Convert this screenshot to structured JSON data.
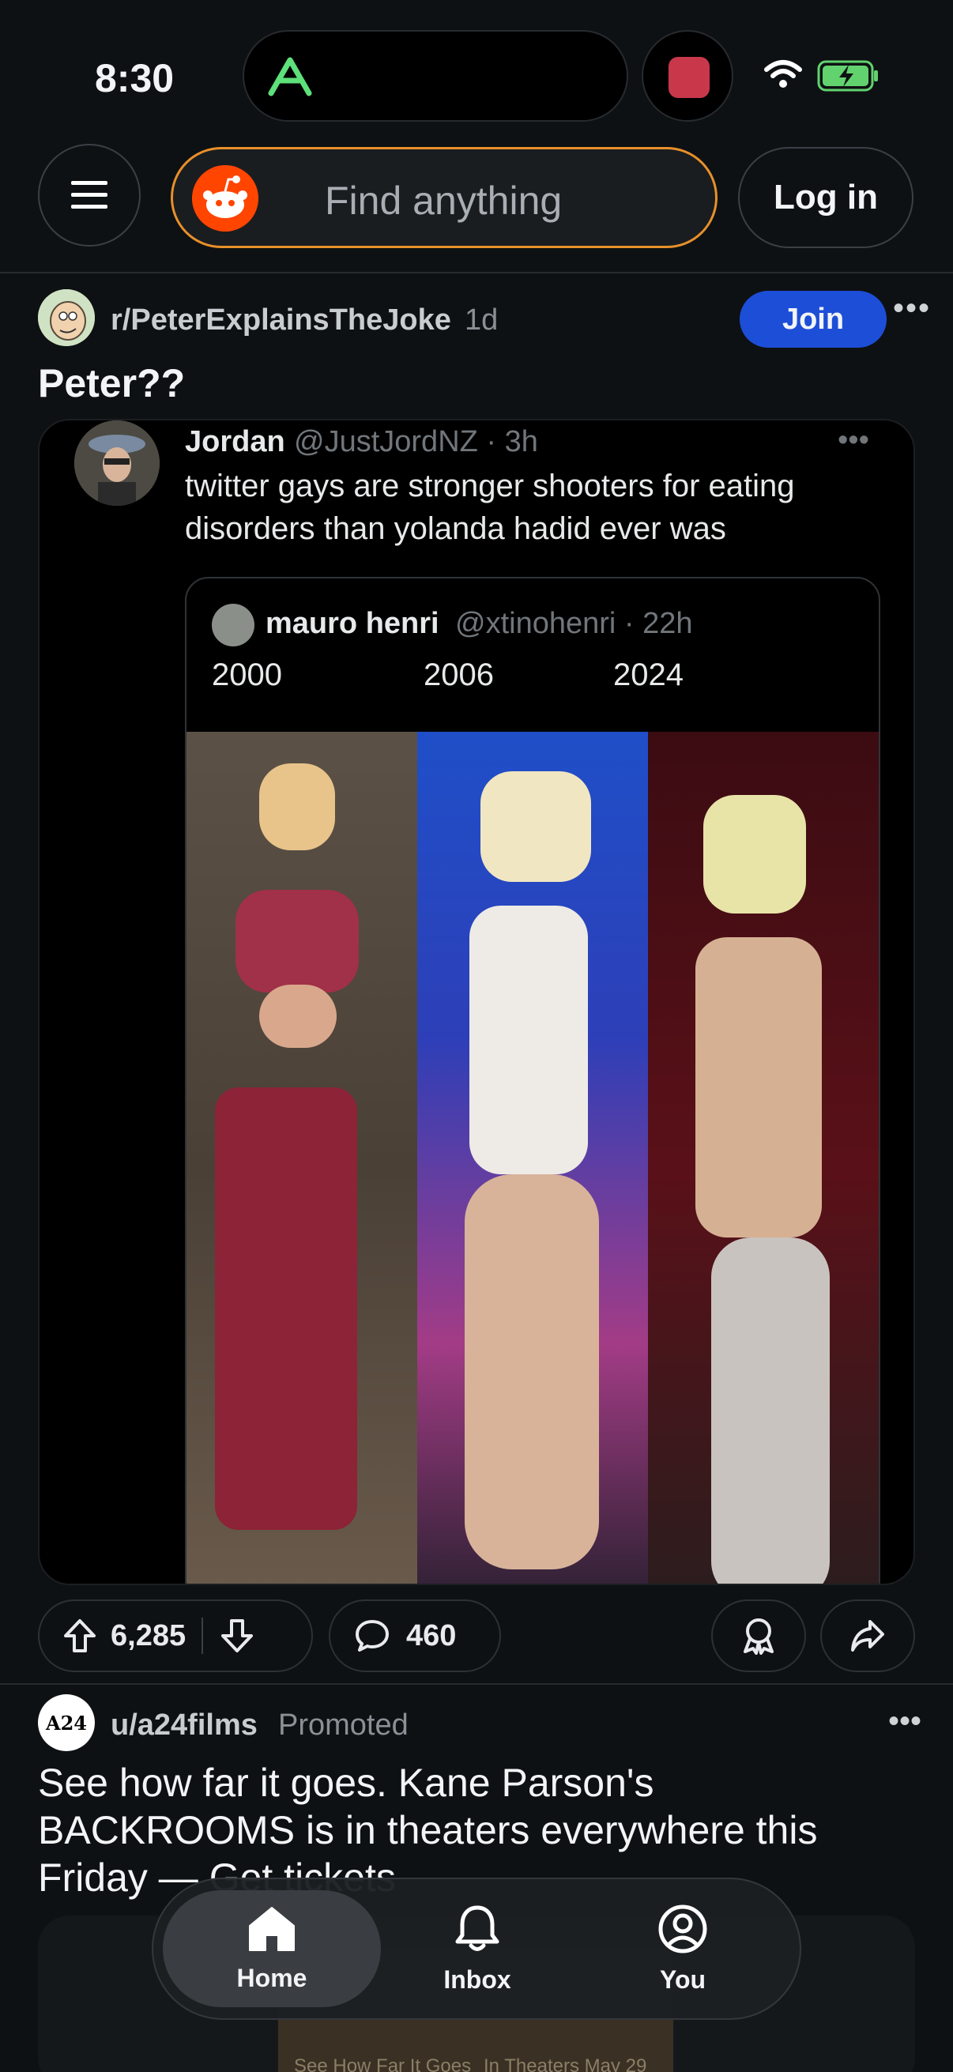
{
  "status": {
    "time": "8:30"
  },
  "header": {
    "search_placeholder": "Find anything",
    "login_label": "Log in"
  },
  "post": {
    "subreddit": "r/PeterExplainsTheJoke",
    "age": "1d",
    "join_label": "Join",
    "title": "Peter??",
    "tweet": {
      "name": "Jordan",
      "handle": "@JustJordNZ · 3h",
      "text": "twitter gays are stronger shooters for eating disorders than yolanda hadid ever was",
      "quote": {
        "name": "mauro henri",
        "handle": "@xtinohenri · 22h",
        "years": [
          "2000",
          "2006",
          "2024"
        ]
      }
    },
    "upvotes": "6,285",
    "comments": "460"
  },
  "promoted": {
    "avatar_text": "A24",
    "user": "u/a24films",
    "tag": "Promoted",
    "title": "See how far it goes. Kane Parson's BACKROOMS is in theaters everywhere this Friday — Get tickets",
    "poster_left": "See How Far It Goes",
    "poster_right": "In Theaters May 29"
  },
  "nav": {
    "tabs": [
      {
        "label": "Home",
        "icon": "home-icon",
        "active": true
      },
      {
        "label": "Inbox",
        "icon": "bell-icon",
        "active": false
      },
      {
        "label": "You",
        "icon": "profile-icon",
        "active": false
      }
    ]
  },
  "colors": {
    "background": "#0e1113",
    "join_blue": "#1d4ed8",
    "reddit_orange": "#ff4500",
    "search_border": "#e8902a"
  }
}
